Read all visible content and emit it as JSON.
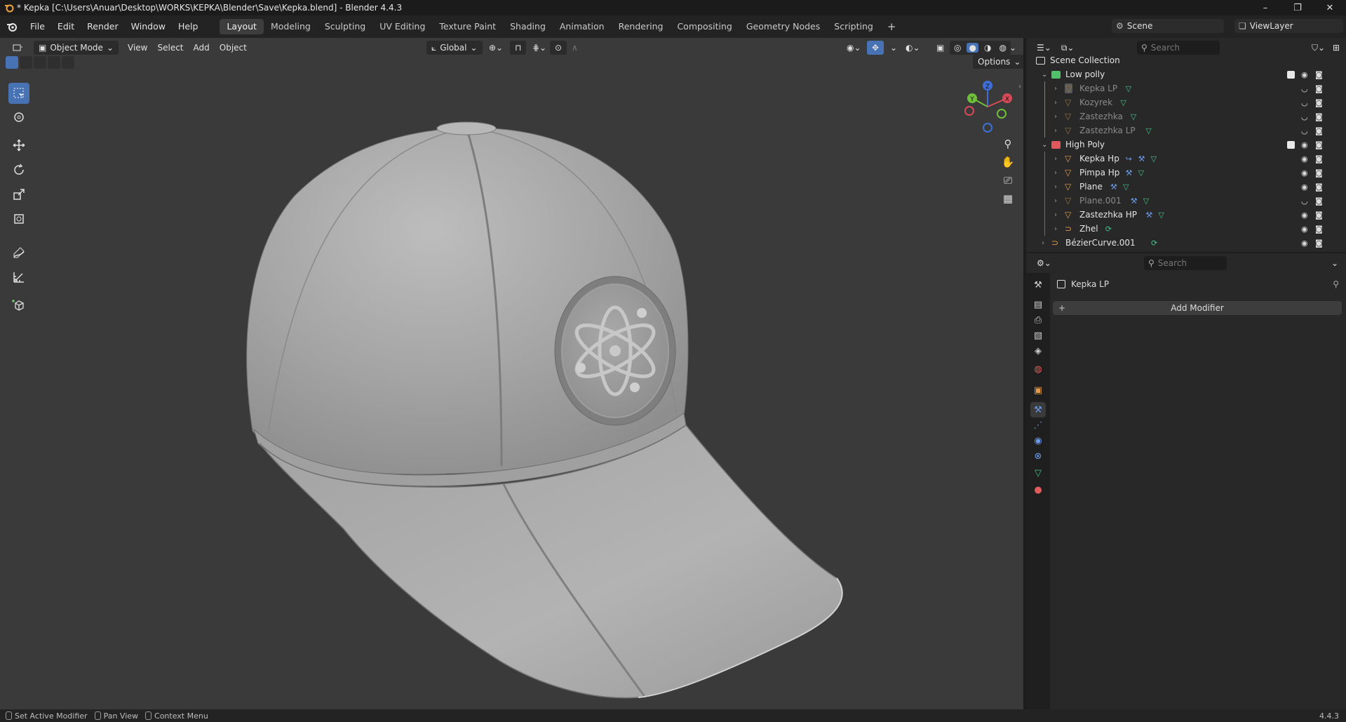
{
  "window": {
    "title": "* Kepka [C:\\Users\\Anuar\\Desktop\\WORKS\\KEPKA\\Blender\\Save\\Kepka.blend] - Blender 4.4.3",
    "minimize": "–",
    "restore": "❐",
    "close": "✕"
  },
  "menu": [
    "File",
    "Edit",
    "Render",
    "Window",
    "Help"
  ],
  "workspaces": [
    "Layout",
    "Modeling",
    "Sculpting",
    "UV Editing",
    "Texture Paint",
    "Shading",
    "Animation",
    "Rendering",
    "Compositing",
    "Geometry Nodes",
    "Scripting"
  ],
  "active_workspace": "Layout",
  "add_workspace": "+",
  "scene": {
    "label": "Scene"
  },
  "view_layer": {
    "label": "ViewLayer"
  },
  "viewport": {
    "mode": "Object Mode",
    "menus": [
      "View",
      "Select",
      "Add",
      "Object"
    ],
    "orientation": "Global",
    "options": "Options",
    "gizmo": {
      "z": "Z",
      "y": "Y",
      "x": "X"
    }
  },
  "outliner": {
    "search_placeholder": "Search",
    "root": "Scene Collection",
    "collections": [
      {
        "name": "Low polly",
        "color": "#4fc26b",
        "items": [
          {
            "name": "Kepka LP",
            "dim": true,
            "active": true,
            "mods": []
          },
          {
            "name": "Kozyrek",
            "dim": true,
            "mods": []
          },
          {
            "name": "Zastezhka",
            "dim": true,
            "mods": []
          },
          {
            "name": "Zastezhka LP",
            "dim": true,
            "mods": []
          }
        ]
      },
      {
        "name": "High Poly",
        "color": "#e0585b",
        "items": [
          {
            "name": "Kepka Hp",
            "dim": false,
            "mods": [
              "constraint-icon",
              "wrench-icon"
            ]
          },
          {
            "name": "Pimpa Hp",
            "dim": false,
            "mods": [
              "wrench-icon"
            ]
          },
          {
            "name": "Plane",
            "dim": false,
            "mods": [
              "wrench-icon"
            ]
          },
          {
            "name": "Plane.001",
            "dim": true,
            "mods": [
              "wrench-icon"
            ]
          },
          {
            "name": "Zastezhka HP",
            "dim": false,
            "mods": [
              "wrench-icon"
            ]
          },
          {
            "name": "Zhel",
            "dim": false,
            "curve": true,
            "mods": []
          }
        ]
      }
    ],
    "extra": {
      "name": "BézierCurve.001"
    }
  },
  "properties": {
    "search_placeholder": "Search",
    "object_name": "Kepka LP",
    "add_modifier": "Add Modifier",
    "add_icon": "+",
    "tabs": [
      "tool-icon",
      "render-icon",
      "output-icon",
      "view-layer-icon",
      "scene-icon",
      "world-icon",
      "object-icon",
      "modifier-icon",
      "particles-icon",
      "physics-icon",
      "constraints-icon",
      "data-icon",
      "material-icon"
    ],
    "active_tab": "modifier-icon"
  },
  "statusbar": {
    "items": [
      "Set Active Modifier",
      "Pan View",
      "Context Menu"
    ],
    "version": "4.4.3"
  },
  "colors": {
    "accent": "#4772b3",
    "viewport_bg": "#3a3a3a",
    "panel_bg": "#282828",
    "object_orange": "#e59a4a",
    "mesh_green": "#46c08a"
  }
}
